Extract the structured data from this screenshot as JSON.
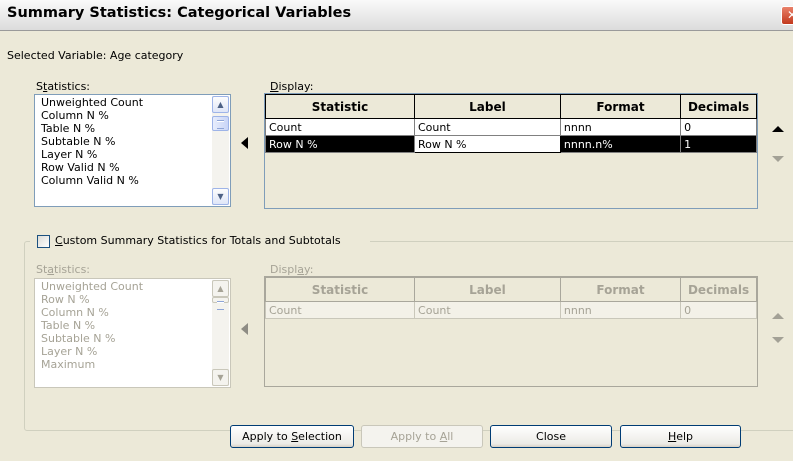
{
  "window": {
    "title": "Summary Statistics: Categorical Variables",
    "close_glyph": "✕"
  },
  "selected_variable": "Selected Variable: Age category",
  "top": {
    "statistics_label": {
      "a": "S",
      "b": "t",
      "c": "atistics:"
    },
    "display_label": {
      "a": "",
      "b": "D",
      "c": "isplay:"
    },
    "stats_list": [
      "Unweighted Count",
      "Column N %",
      "Table N %",
      "Subtable N %",
      "Layer N %",
      "Row Valid N %",
      "Column Valid N %"
    ],
    "columns": [
      "Statistic",
      "Label",
      "Format",
      "Decimals"
    ],
    "rows": [
      {
        "statistic": "Count",
        "label": "Count",
        "format": "nnnn",
        "decimals": "0"
      },
      {
        "statistic": "Row N %",
        "label": "Row N %",
        "format": "nnnn.n%",
        "decimals": "1"
      }
    ],
    "selected_row": 1
  },
  "custom": {
    "checkbox_label": {
      "a": "",
      "b": "C",
      "c": "ustom Summary Statistics for Totals and Subtotals"
    },
    "checked": false,
    "statistics_label": {
      "a": "St",
      "b": "a",
      "c": "tistics:"
    },
    "display_label": {
      "a": "Displ",
      "b": "a",
      "c": "y:"
    },
    "stats_list": [
      "Unweighted Count",
      "Row N %",
      "Column N %",
      "Table N %",
      "Subtable N %",
      "Layer N %",
      "Maximum"
    ],
    "columns": [
      "Statistic",
      "Label",
      "Format",
      "Decimals"
    ],
    "rows": [
      {
        "statistic": "Count",
        "label": "Count",
        "format": "nnnn",
        "decimals": "0"
      }
    ]
  },
  "buttons": {
    "apply_selection": {
      "a": "Apply to ",
      "b": "S",
      "c": "election"
    },
    "apply_all": {
      "a": "Apply to ",
      "b": "A",
      "c": "ll"
    },
    "close": {
      "a": "Close",
      "b": "",
      "c": ""
    },
    "help": {
      "a": "",
      "b": "H",
      "c": "elp"
    }
  },
  "colors": {
    "accent": "#003c74",
    "selection": "#000000",
    "disabled_text": "#a6a396"
  },
  "icons": {
    "scroll_up": "▲",
    "scroll_down": "▼"
  }
}
